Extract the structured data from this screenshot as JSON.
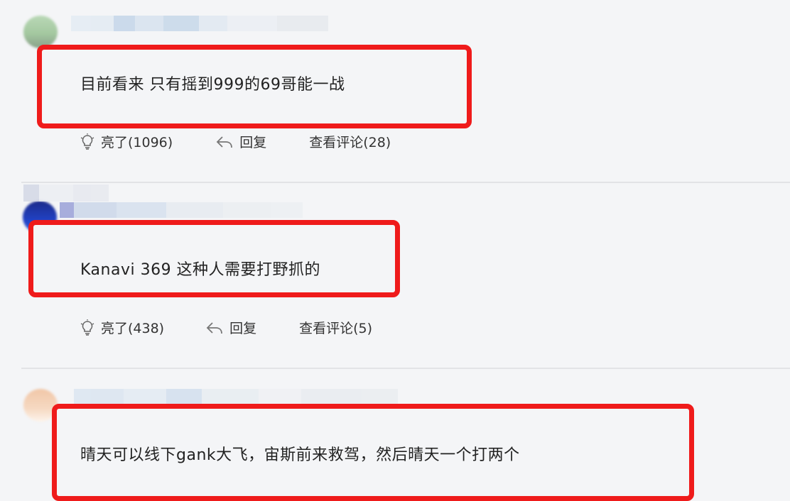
{
  "comments": [
    {
      "text": "目前看来 只有摇到999的69哥能一战",
      "like_label": "亮了(1096)",
      "reply_label": "回复",
      "view_label": "查看评论(28)"
    },
    {
      "text": "Kanavi 369 这种人需要打野抓的",
      "like_label": "亮了(438)",
      "reply_label": "回复",
      "view_label": "查看评论(5)"
    },
    {
      "text": "晴天可以线下gank大飞，宙斯前来救驾，然后晴天一个打两个"
    }
  ],
  "colors": {
    "highlight": "#ef1b1b",
    "background": "#f4f5f7",
    "divider": "#e2e3e6"
  },
  "icons": [
    "bulb-icon",
    "reply-arrow-icon"
  ]
}
